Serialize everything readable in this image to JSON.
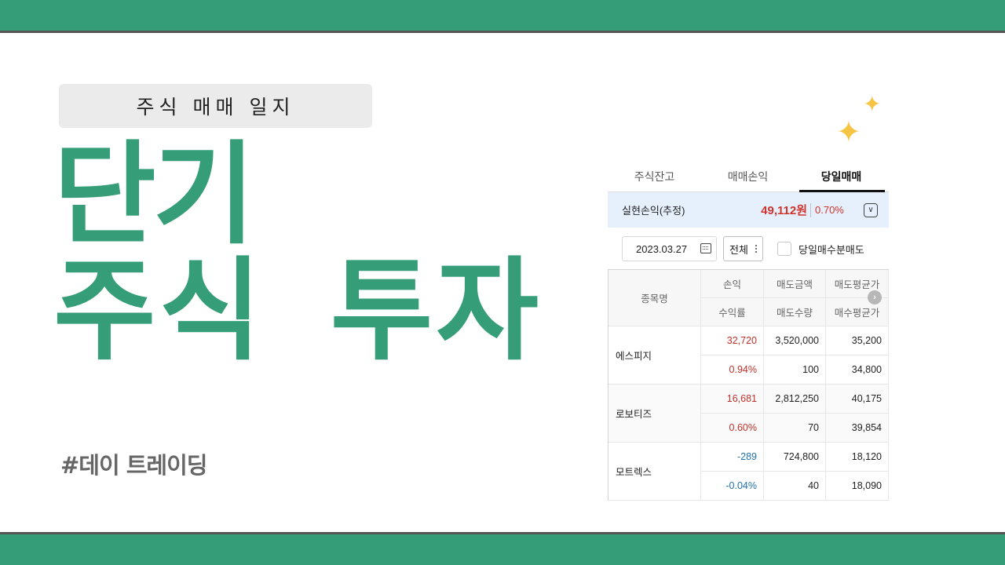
{
  "tag": "주식 매매 일지",
  "title_line1": "단기",
  "title_line2": "주식 투자",
  "hashtag": "#데이 트레이딩",
  "sparkle_glyph": "✦",
  "tabs": [
    {
      "label": "주식잔고"
    },
    {
      "label": "매매손익"
    },
    {
      "label": "당일매매"
    }
  ],
  "summary": {
    "label": "실현손익(추정)",
    "amount": "49,112원",
    "percent": "0.70%",
    "toggle_glyph": "∨"
  },
  "filters": {
    "date": "2023.03.27",
    "select": "전체",
    "checkbox_label": "당일매수분매도"
  },
  "table": {
    "headers": {
      "name": "종목명",
      "profit": "손익",
      "rate": "수익률",
      "sell_amount": "매도금액",
      "sell_qty": "매도수량",
      "sell_avg": "매도평균가",
      "buy_avg": "매수평균가"
    },
    "scroll_glyph": "›",
    "rows": [
      {
        "name": "에스피지",
        "profit": "32,720",
        "rate": "0.94%",
        "sell_amount": "3,520,000",
        "sell_qty": "100",
        "sell_avg": "35,200",
        "buy_avg": "34,800"
      },
      {
        "name": "로보티즈",
        "profit": "16,681",
        "rate": "0.60%",
        "sell_amount": "2,812,250",
        "sell_qty": "70",
        "sell_avg": "40,175",
        "buy_avg": "39,854"
      },
      {
        "name": "모트렉스",
        "profit": "-289",
        "rate": "-0.04%",
        "sell_amount": "724,800",
        "sell_qty": "40",
        "sell_avg": "18,120",
        "buy_avg": "18,090"
      }
    ]
  },
  "colors": {
    "brand_green": "#359e78",
    "profit_red": "#c0302a",
    "loss_blue": "#2171b0",
    "sparkle": "#f5c443"
  }
}
